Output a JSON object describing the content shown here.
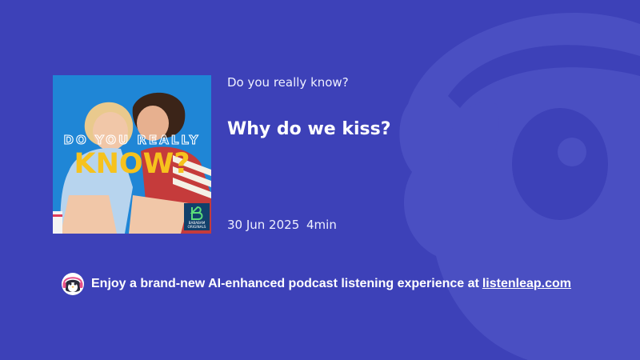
{
  "podcast": {
    "show_title": "Do you really know?",
    "episode_title": "Why do we kiss?",
    "date": "30 Jun 2025",
    "duration": "4min"
  },
  "cover_art": {
    "line1": "DO YOU REALLY",
    "line2": "KNOW?",
    "badge_line1": "BABABAM",
    "badge_line2": "ORIGINALS"
  },
  "promo": {
    "text": "Enjoy a brand-new AI-enhanced podcast listening experience at",
    "link_text": "listenleap.com",
    "icon": "penguin-headphones-icon"
  },
  "colors": {
    "background": "#3d41b8",
    "cover_background": "#1f86d6",
    "cover_title_yellow": "#f6c21d"
  }
}
